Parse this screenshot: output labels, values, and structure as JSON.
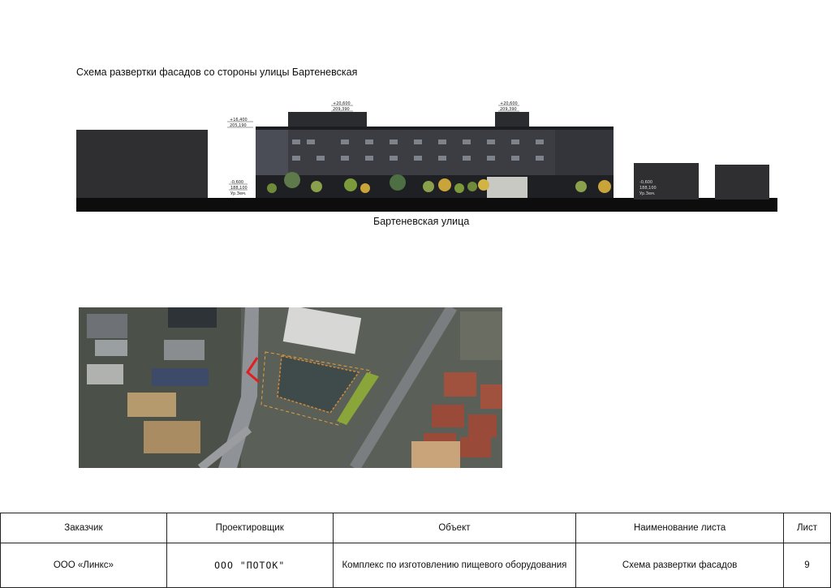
{
  "page_title": "Схема развертки фасадов со стороны улицы Бартеневская",
  "street_label": "Бартеневская улица",
  "elevation_marks": [
    {
      "top": "+16,400",
      "bottom": "205,190"
    },
    {
      "top": "+20,600",
      "bottom": "209,390"
    },
    {
      "top": "+20,600",
      "bottom": "209,390"
    },
    {
      "top": "-0,600",
      "bottom": "188,100",
      "note": "Ур.Зем."
    },
    {
      "top": "-0,600",
      "bottom": "188,100",
      "note": "Ур.Зем."
    }
  ],
  "stamp": {
    "headers": {
      "customer": "Заказчик",
      "designer": "Проектировщик",
      "object": "Объект",
      "sheet_name": "Наименование листа",
      "sheet": "Лист"
    },
    "values": {
      "customer": "ООО «Линкс»",
      "designer": "ООО \"ПОТОК\"",
      "object": "Комплекс по изготовлению пищевого оборудования",
      "sheet_name": "Схема развертки фасадов",
      "sheet": "9"
    }
  },
  "colors": {
    "building_dark": "#2f2f31",
    "ground": "#0d0d0d",
    "facade": "#3b3d42",
    "route_marker": "#e02020"
  }
}
